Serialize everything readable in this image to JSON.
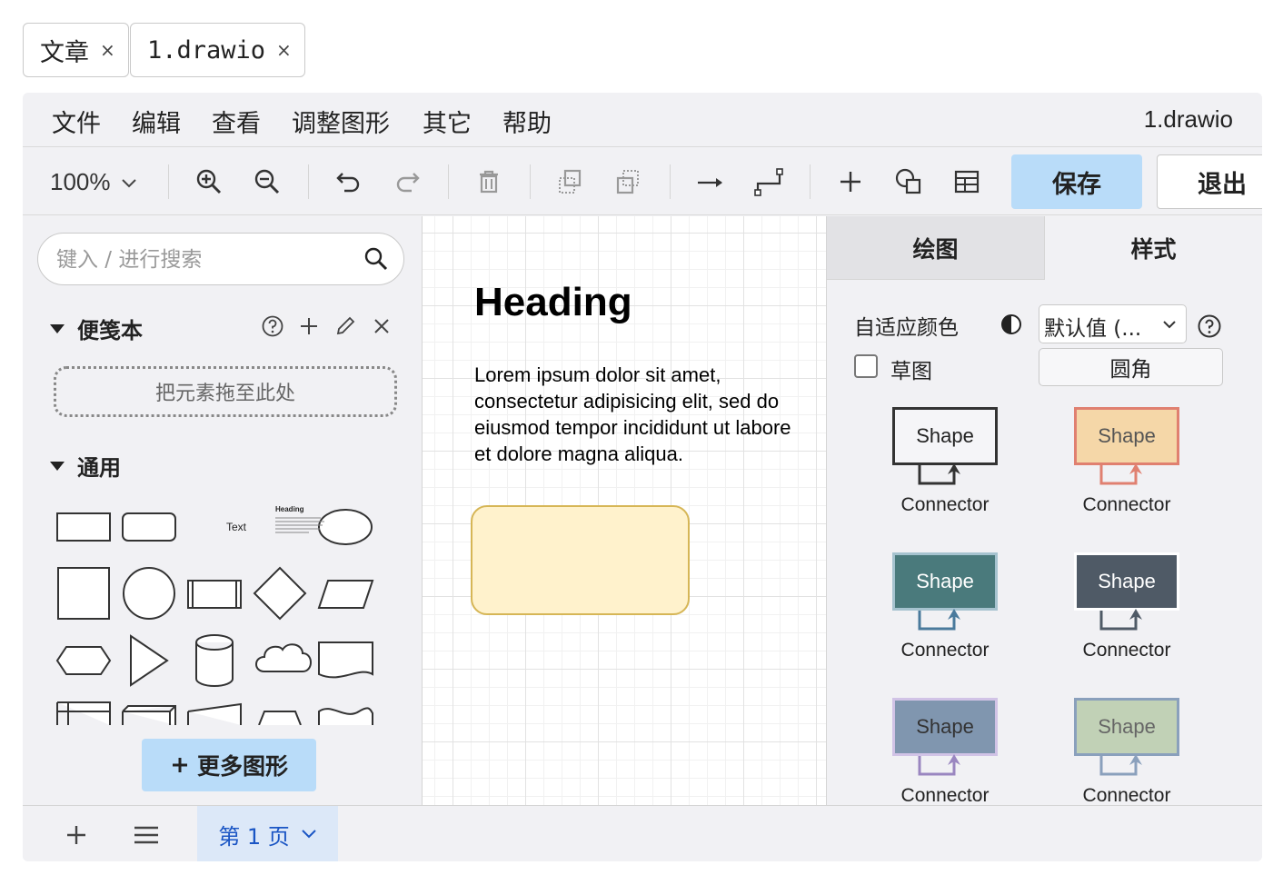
{
  "file_tabs": [
    {
      "label": "文章",
      "close": "×"
    },
    {
      "label": "1.drawio",
      "close": "×"
    }
  ],
  "menubar": {
    "items": [
      "文件",
      "编辑",
      "查看",
      "调整图形",
      "其它",
      "帮助"
    ],
    "doc_title": "1.drawio"
  },
  "toolbar": {
    "zoom": "100%",
    "save_label": "保存",
    "exit_label": "退出",
    "icons": [
      "zoom-in",
      "zoom-out",
      "undo",
      "redo",
      "delete",
      "to-front",
      "to-back",
      "connection-arrow",
      "waypoints",
      "insert",
      "shapes",
      "table"
    ]
  },
  "left_panel": {
    "search_placeholder": "键入 / 进行搜索",
    "scratchpad_title": "便笺本",
    "dropzone_text": "把元素拖至此处",
    "general_title": "通用",
    "text_shape_label": "Text",
    "heading_shape_label": "Heading",
    "more_shapes_label": "更多图形"
  },
  "canvas": {
    "heading": "Heading",
    "body": "Lorem ipsum dolor sit amet, consectetur adipisicing elit, sed do eiusmod tempor incididunt ut labore et dolore magna aliqua.",
    "rect_fill": "#fff2cc",
    "rect_stroke": "#d6b656"
  },
  "right_panel": {
    "tabs": [
      "绘图",
      "样式"
    ],
    "adaptive_color_label": "自适应颜色",
    "default_select": "默认值 (...",
    "sketch_label": "草图",
    "rounded_label": "圆角",
    "styles": [
      {
        "shape": "Shape",
        "connector": "Connector",
        "fill": "#f5f5f8",
        "stroke": "#333333",
        "text": "#222222",
        "line": "#333333"
      },
      {
        "shape": "Shape",
        "connector": "Connector",
        "fill": "#f5d7a8",
        "stroke": "#e08070",
        "text": "#555555",
        "line": "#e08070"
      },
      {
        "shape": "Shape",
        "connector": "Connector",
        "fill": "#4a7a7c",
        "stroke": "#a6c3cf",
        "text": "#ffffff",
        "line": "#4a7a9c"
      },
      {
        "shape": "Shape",
        "connector": "Connector",
        "fill": "#4f5a66",
        "stroke": "#ffffff",
        "text": "#ffffff",
        "line": "#4f5a66"
      },
      {
        "shape": "Shape",
        "connector": "Connector",
        "fill": "#8096af",
        "stroke": "#d1c3e6",
        "text": "#333333",
        "line": "#9a86c0"
      },
      {
        "shape": "Shape",
        "connector": "Connector",
        "fill": "#c1d1b6",
        "stroke": "#8aa0bc",
        "text": "#666666",
        "line": "#8aa0bc"
      }
    ]
  },
  "bottombar": {
    "page_label": "第 1 页"
  }
}
